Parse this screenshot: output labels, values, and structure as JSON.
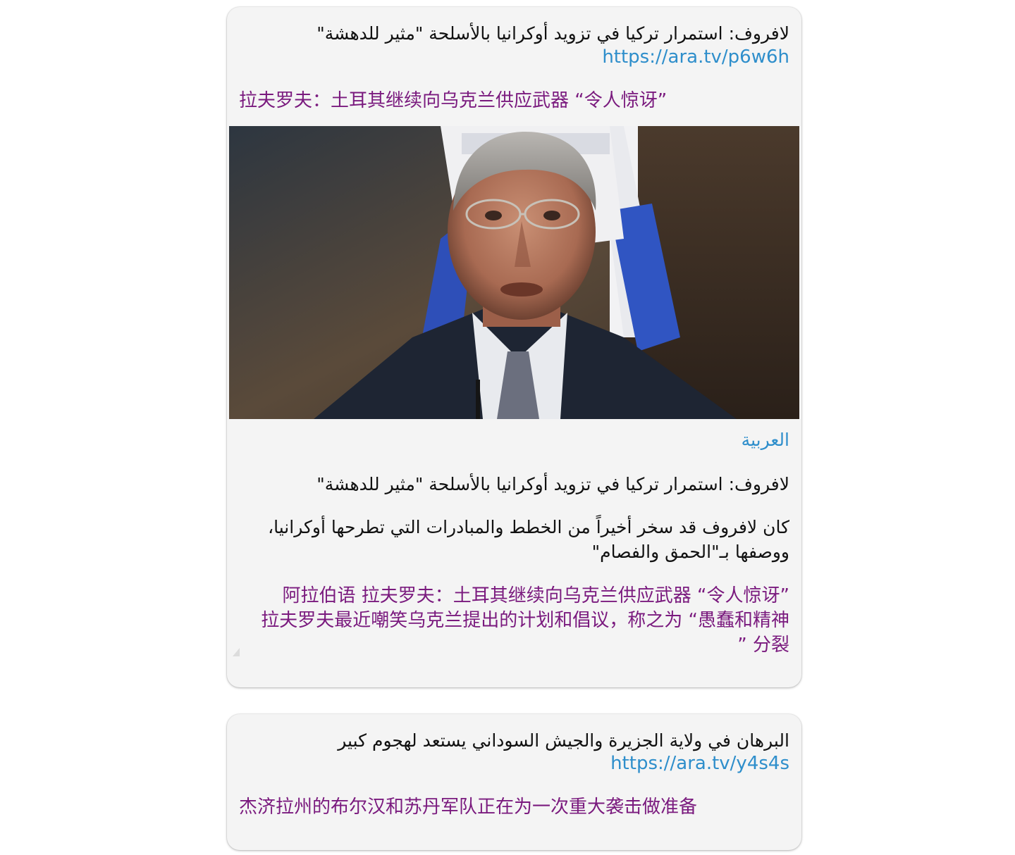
{
  "messages": [
    {
      "arabic_headline": "لافروف: استمرار تركيا في تزويد أوكرانيا بالأسلحة \"مثير للدهشة\"",
      "link": "https://ara.tv/p6w6h",
      "chinese_headline": "拉夫罗夫：土耳其继续向乌克兰供应武器 “令人惊讶”",
      "preview": {
        "image_icon": "portrait-photo",
        "site_name": "العربية",
        "title": "لافروف: استمرار تركيا في تزويد أوكرانيا بالأسلحة \"مثير للدهشة\"",
        "description": "كان لافروف قد سخر أخيراً من الخطط والمبادرات التي تطرحها أوكرانيا، ووصفها بـ\"الحمق والفصام\""
      },
      "chinese_translation_line1": "阿拉伯语 拉夫罗夫：土耳其继续向乌克兰供应武器 “令人惊讶”",
      "chinese_translation_line2": "拉夫罗夫最近嘲笑乌克兰提出的计划和倡议，称之为 “愚蠢和精神",
      "chinese_translation_line3": "” 分裂"
    },
    {
      "arabic_headline": "البرهان في ولاية الجزيرة والجيش السوداني يستعد لهجوم كبير",
      "link": "https://ara.tv/y4s4s",
      "chinese_headline": "杰济拉州的布尔汉和苏丹军队正在为一次重大袭击做准备"
    }
  ],
  "colors": {
    "bubble": "#f4f4f4",
    "link": "#2e8ecb",
    "chinese_text": "#7a1a7e",
    "text": "#111111"
  }
}
